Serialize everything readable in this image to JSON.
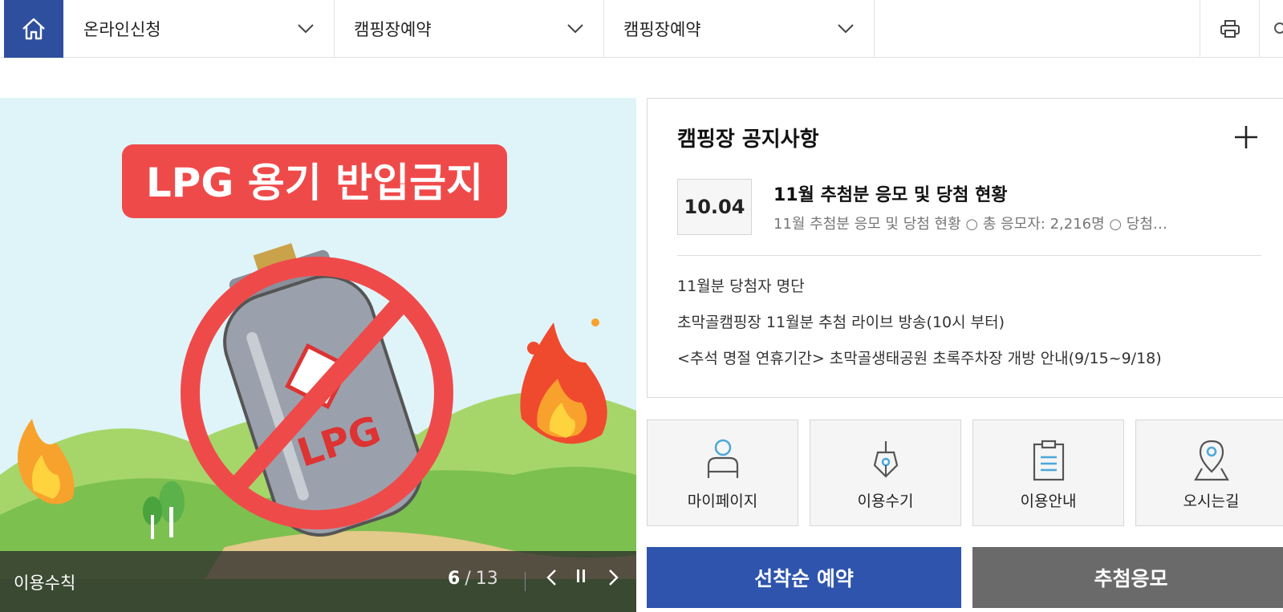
{
  "nav": {
    "home_label": "",
    "menu1": "온라인신청",
    "menu2": "캠핑장예약",
    "menu3": "캠핑장예약"
  },
  "banner": {
    "headline": "LPG 용기 반입금지",
    "can_text": "LPG",
    "slide_title": "이용수칙",
    "current": "6",
    "separator": "/",
    "total": "13"
  },
  "notice": {
    "title": "캠핑장 공지사항",
    "featured": {
      "date": "10.04",
      "title": "11월 추첨분 응모 및 당첨 현황",
      "summary": "11월 추첨분 응모 및 당첨 현황 ○ 총 응모자: 2,216명 ○ 당첨…"
    },
    "items": [
      "11월분 당첨자 명단",
      "초막골캠핑장 11월분 추첨 라이브 방송(10시 부터)",
      "<추석 명절 연휴기간> 초막골생태공원 초록주차장 개방 안내(9/15~9/18)"
    ]
  },
  "quick_menu": [
    {
      "label": "마이페이지",
      "icon": "person-icon"
    },
    {
      "label": "이용수기",
      "icon": "pen-icon"
    },
    {
      "label": "이용안내",
      "icon": "clipboard-icon"
    },
    {
      "label": "오시는길",
      "icon": "map-pin-icon"
    }
  ],
  "buttons": {
    "reserve": "선착순 예약",
    "lottery": "추첨응모"
  },
  "colors": {
    "brand_blue": "#2e4f9e",
    "reserve_blue": "#2e54ad",
    "lottery_gray": "#6a6a6a",
    "icon_accent": "#4aa8d8",
    "banner_red": "#ef4a4a"
  }
}
